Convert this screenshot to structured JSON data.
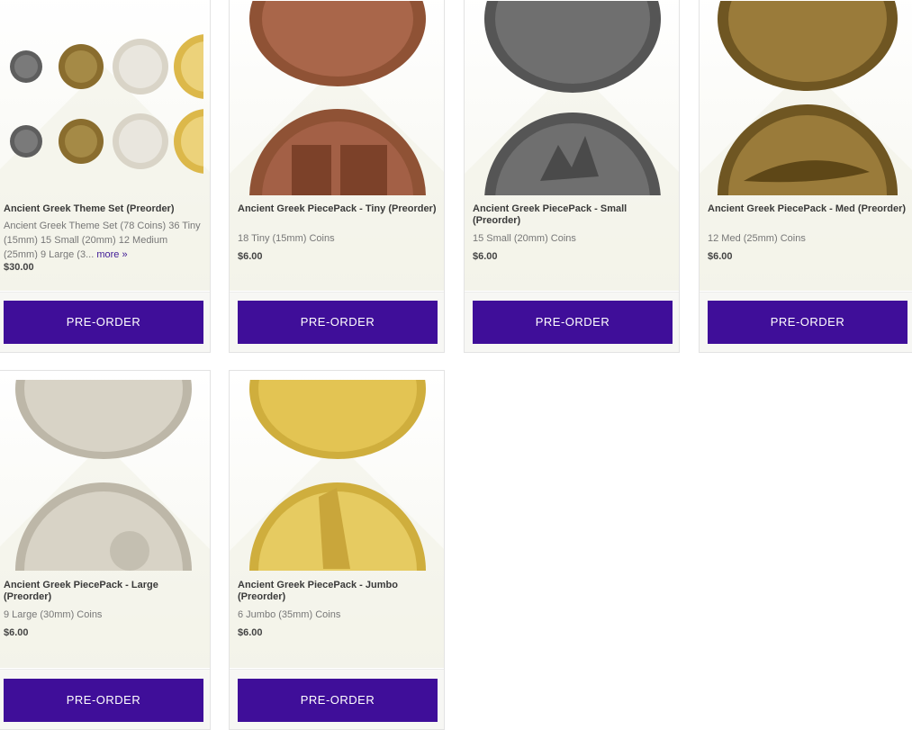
{
  "products": [
    {
      "title": "Ancient Greek Theme Set (Preorder)",
      "description": "Ancient Greek Theme Set (78 Coins) 36 Tiny (15mm) 15 Small (20mm) 12 Medium (25mm) 9 Large (3...",
      "more_label": "more »",
      "price": "$30.00",
      "button_label": "PRE-ORDER"
    },
    {
      "title": "Ancient Greek PiecePack - Tiny (Preorder)",
      "description": "18 Tiny (15mm) Coins",
      "price": "$6.00",
      "button_label": "PRE-ORDER"
    },
    {
      "title": "Ancient Greek PiecePack - Small (Preorder)",
      "description": "15 Small (20mm) Coins",
      "price": "$6.00",
      "button_label": "PRE-ORDER"
    },
    {
      "title": "Ancient Greek PiecePack - Med (Preorder)",
      "description": "12 Med (25mm) Coins",
      "price": "$6.00",
      "button_label": "PRE-ORDER"
    },
    {
      "title": "Ancient Greek PiecePack - Large (Preorder)",
      "description": "9 Large (30mm) Coins",
      "price": "$6.00",
      "button_label": "PRE-ORDER"
    },
    {
      "title": "Ancient Greek PiecePack - Jumbo (Preorder)",
      "description": "6 Jumbo (35mm) Coins",
      "price": "$6.00",
      "button_label": "PRE-ORDER"
    }
  ],
  "colors": {
    "button": "#3f0e99",
    "button_text": "#ffffff",
    "link": "#3f1a96",
    "copper": "#9a5a3c",
    "pewter": "#6f6f6f",
    "bronze": "#8a6d2e",
    "silver": "#d8d3c6",
    "gold": "#e3c453"
  }
}
